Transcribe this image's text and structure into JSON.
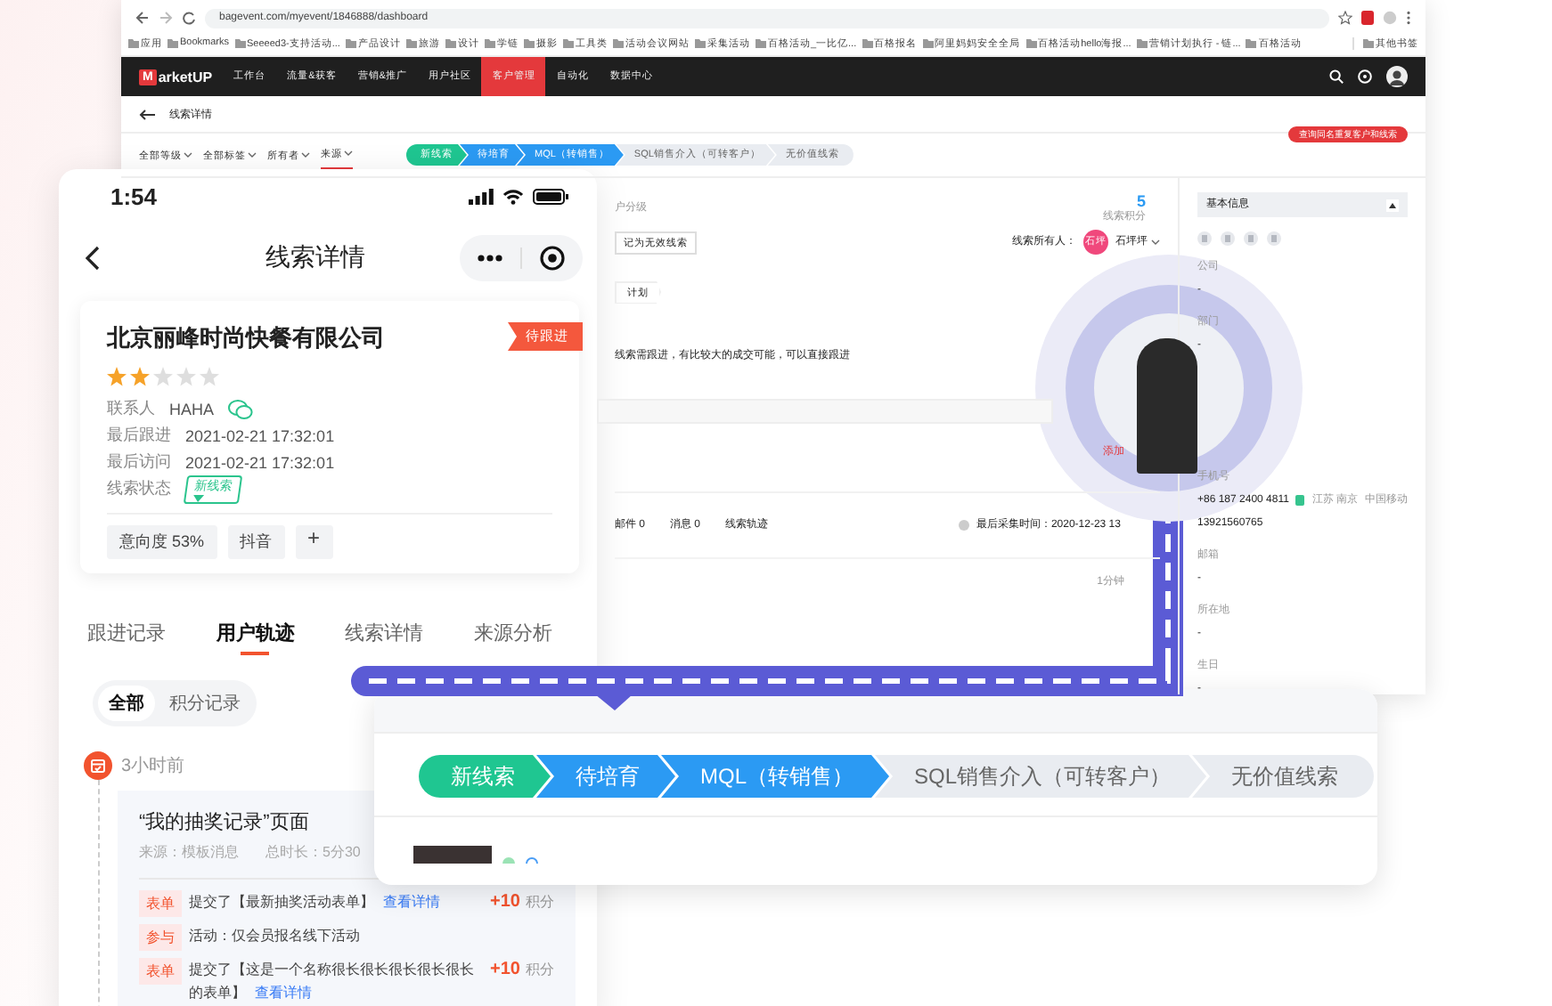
{
  "browser": {
    "url": "bagevent.com/myevent/1846888/dashboard",
    "bookmarks": [
      "应用",
      "Bookmarks",
      "Seeeed3-支持活动...",
      "产品设计",
      "旅游",
      "设计",
      "学链",
      "摄影",
      "工具类",
      "活动会议网站",
      "采集活动",
      "百格活动_一比亿...",
      "百格报名",
      "阿里妈妈安全全局",
      "百格活动hello海报...",
      "营销计划执行 - 链...",
      "百格活动"
    ],
    "other_bookmarks": "其他书签",
    "logo_mark": "M",
    "logo": "arketUP",
    "nav": [
      {
        "label": "工作台",
        "selected": false
      },
      {
        "label": "流量&获客",
        "selected": false
      },
      {
        "label": "营销&推广",
        "selected": false
      },
      {
        "label": "用户社区",
        "selected": false
      },
      {
        "label": "客户管理",
        "selected": true
      },
      {
        "label": "自动化",
        "selected": false
      },
      {
        "label": "数据中心",
        "selected": false
      }
    ],
    "page_title": "线索详情",
    "filters": [
      "全部等级",
      "全部标签",
      "所有者",
      "来源"
    ],
    "stages": [
      {
        "label": "新线索",
        "kind": "start"
      },
      {
        "label": "待培育",
        "kind": "passed"
      },
      {
        "label": "MQL（转销售）",
        "kind": "passed"
      },
      {
        "label": "SQL销售介入（可转客户）",
        "kind": "pending"
      },
      {
        "label": "无价值线索",
        "kind": "pending"
      }
    ],
    "alert_button": "查询同名重复客户和线索",
    "lead": {
      "level_label": "户分级",
      "invalid_button": "记为无效线索",
      "score": "5",
      "score_label": "线索积分",
      "owner_label": "线索所有人：",
      "owner_avatar": "石坪",
      "owner": "石坪坪",
      "plan": "计划",
      "note": "线索需跟进，有比较大的成交可能，可以直接跟进",
      "add_link": "添加",
      "counters": [
        "邮件 0",
        "消息 0",
        "线索轨迹"
      ],
      "last_collect": "最后采集时间：2020-12-23 13",
      "elapsed": "1分钟"
    },
    "basic_info": {
      "title": "基本信息",
      "fields": [
        {
          "label": "公司",
          "value": "-"
        },
        {
          "label": "部门",
          "value": "-"
        },
        {
          "label": "手机号",
          "value": "+86 187 2400 4811",
          "region": "江苏 南京",
          "carrier": "中国移动",
          "extra": "13921560765"
        },
        {
          "label": "邮箱",
          "value": "-"
        },
        {
          "label": "所在地",
          "value": "-"
        },
        {
          "label": "生日",
          "value": "-"
        }
      ]
    }
  },
  "phone": {
    "time": "1:54",
    "title": "线索详情",
    "lead": {
      "company": "北京丽峰时尚快餐有限公司",
      "badge": "待跟进",
      "stars": 2,
      "rows": [
        {
          "label": "联系人",
          "value": "HAHA",
          "kind": "contact"
        },
        {
          "label": "最后跟进",
          "value": "2021-02-21 17:32:01",
          "kind": "text"
        },
        {
          "label": "最后访问",
          "value": "2021-02-21 17:32:01",
          "kind": "text"
        },
        {
          "label": "线索状态",
          "value": "新线索",
          "kind": "status"
        }
      ],
      "tags": [
        "意向度 53%",
        "抖音"
      ],
      "add": "+"
    },
    "tabs": [
      {
        "label": "跟进记录",
        "selected": false
      },
      {
        "label": "用户轨迹",
        "selected": true
      },
      {
        "label": "线索详情",
        "selected": false
      },
      {
        "label": "来源分析",
        "selected": false
      }
    ],
    "segments": [
      {
        "label": "全部",
        "selected": true
      },
      {
        "label": "积分记录",
        "selected": false
      }
    ],
    "timeline": {
      "time": "3小时前",
      "title": "“我的抽奖记录”页面",
      "source": "来源：模板消息",
      "duration": "总时长：5分30",
      "records": [
        {
          "tag": "表单",
          "text": "提交了【最新抽奖活动表单】",
          "link": "查看详情",
          "points": "+10",
          "unit": "积分"
        },
        {
          "tag": "参与",
          "text": "活动：仅会员报名线下活动"
        },
        {
          "tag": "表单",
          "text": "提交了【这是一个名称很长很长很长很长很长的表单】",
          "link": "查看详情",
          "points": "+10",
          "unit": "积分"
        }
      ]
    }
  },
  "stage_card": {
    "stages": [
      {
        "label": "新线索",
        "kind": "start"
      },
      {
        "label": "待培育",
        "kind": "passed"
      },
      {
        "label": "MQL（转销售）",
        "kind": "passed"
      },
      {
        "label": "SQL销售介入（可转客户）",
        "kind": "pending"
      },
      {
        "label": "无价值线索",
        "kind": "pending"
      }
    ]
  }
}
